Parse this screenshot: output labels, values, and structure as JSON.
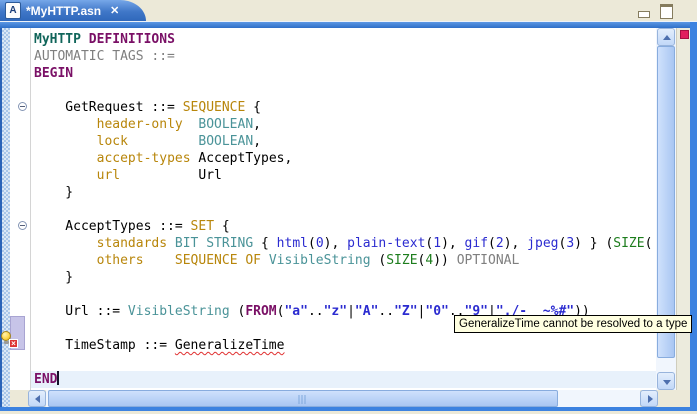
{
  "tab": {
    "title": "*MyHTTP.asn",
    "icon_letter": "A",
    "close_glyph": "✕"
  },
  "icons": {
    "error_x": "×"
  },
  "tooltip": {
    "text": "GeneralizeTime cannot be resolved to a type"
  },
  "colors": {
    "tab_blue": "#3c74c4",
    "frame_blue": "#3c82e0",
    "keyword_purple": "#7a1066",
    "module_green": "#10655a",
    "type_teal": "#4a9398",
    "field_orange": "#b8860b",
    "enum_blue": "#2b2bd0",
    "size_green": "#1d7d1d",
    "comment_gray": "#7f7f7f",
    "error_red": "#e03030",
    "current_line_bg": "#e8f1fb",
    "tooltip_bg": "#ffffe1",
    "annotation_lavender": "#c7c4e8",
    "overview_error_pink": "#f7b6cd",
    "overview_summary_red": "#e11e5e"
  },
  "code": {
    "lines": [
      {
        "seg": [
          [
            "m",
            "MyHTTP"
          ],
          [
            "p",
            " "
          ],
          [
            "k",
            "DEFINITIONS"
          ]
        ]
      },
      {
        "seg": [
          [
            "g",
            "AUTOMATIC TAGS ::="
          ]
        ]
      },
      {
        "seg": [
          [
            "k",
            "BEGIN"
          ]
        ]
      },
      {
        "seg": []
      },
      {
        "fold": true,
        "seg": [
          [
            "p",
            "    GetRequest ::= "
          ],
          [
            "o",
            "SEQUENCE"
          ],
          [
            "p",
            " {"
          ]
        ]
      },
      {
        "seg": [
          [
            "p",
            "        "
          ],
          [
            "o",
            "header-only"
          ],
          [
            "p",
            "  "
          ],
          [
            "t",
            "BOOLEAN"
          ],
          [
            "p",
            ","
          ]
        ]
      },
      {
        "seg": [
          [
            "p",
            "        "
          ],
          [
            "o",
            "lock"
          ],
          [
            "p",
            "         "
          ],
          [
            "t",
            "BOOLEAN"
          ],
          [
            "p",
            ","
          ]
        ]
      },
      {
        "seg": [
          [
            "p",
            "        "
          ],
          [
            "o",
            "accept-types"
          ],
          [
            "p",
            " AcceptTypes,"
          ]
        ]
      },
      {
        "seg": [
          [
            "p",
            "        "
          ],
          [
            "o",
            "url"
          ],
          [
            "p",
            "          Url"
          ]
        ]
      },
      {
        "seg": [
          [
            "p",
            "    }"
          ]
        ]
      },
      {
        "seg": []
      },
      {
        "fold": true,
        "seg": [
          [
            "p",
            "    AcceptTypes ::= "
          ],
          [
            "o",
            "SET"
          ],
          [
            "p",
            " {"
          ]
        ]
      },
      {
        "seg": [
          [
            "p",
            "        "
          ],
          [
            "o",
            "standards"
          ],
          [
            "p",
            " "
          ],
          [
            "t",
            "BIT STRING"
          ],
          [
            "p",
            " { "
          ],
          [
            "b",
            "html"
          ],
          [
            "p",
            "("
          ],
          [
            "b",
            "0"
          ],
          [
            "p",
            "), "
          ],
          [
            "b",
            "plain-text"
          ],
          [
            "p",
            "("
          ],
          [
            "b",
            "1"
          ],
          [
            "p",
            "), "
          ],
          [
            "b",
            "gif"
          ],
          [
            "p",
            "("
          ],
          [
            "b",
            "2"
          ],
          [
            "p",
            "), "
          ],
          [
            "b",
            "jpeg"
          ],
          [
            "p",
            "("
          ],
          [
            "b",
            "3"
          ],
          [
            "p",
            ") } ("
          ],
          [
            "n",
            "SIZE"
          ],
          [
            "p",
            "("
          ]
        ]
      },
      {
        "seg": [
          [
            "p",
            "        "
          ],
          [
            "o",
            "others"
          ],
          [
            "p",
            "    "
          ],
          [
            "o",
            "SEQUENCE OF"
          ],
          [
            "p",
            " "
          ],
          [
            "t",
            "VisibleString"
          ],
          [
            "p",
            " ("
          ],
          [
            "n",
            "SIZE"
          ],
          [
            "p",
            "("
          ],
          [
            "n",
            "4"
          ],
          [
            "p",
            ")) "
          ],
          [
            "g",
            "OPTIONAL"
          ]
        ]
      },
      {
        "seg": [
          [
            "p",
            "    }"
          ]
        ]
      },
      {
        "seg": []
      },
      {
        "seg": [
          [
            "p",
            "    Url ::= "
          ],
          [
            "t",
            "VisibleString"
          ],
          [
            "p",
            " ("
          ],
          [
            "k",
            "FROM"
          ],
          [
            "p",
            "("
          ],
          [
            "s",
            "\"a\""
          ],
          [
            "p",
            ".."
          ],
          [
            "s",
            "\"z\""
          ],
          [
            "p",
            "|"
          ],
          [
            "s",
            "\"A\""
          ],
          [
            "p",
            ".."
          ],
          [
            "s",
            "\"Z\""
          ],
          [
            "p",
            "|"
          ],
          [
            "s",
            "\"0\""
          ],
          [
            "p",
            ".."
          ],
          [
            "s",
            "\"9\""
          ],
          [
            "p",
            "|"
          ],
          [
            "s",
            "\"./-_ ~%#\""
          ],
          [
            "p",
            "))"
          ]
        ]
      },
      {
        "seg": []
      },
      {
        "seg": [
          [
            "p",
            "    TimeStamp ::= "
          ],
          [
            "e",
            "GeneralizeTime"
          ]
        ]
      },
      {
        "seg": []
      },
      {
        "cur": true,
        "caret": true,
        "seg": [
          [
            "k",
            "END"
          ]
        ]
      }
    ]
  }
}
